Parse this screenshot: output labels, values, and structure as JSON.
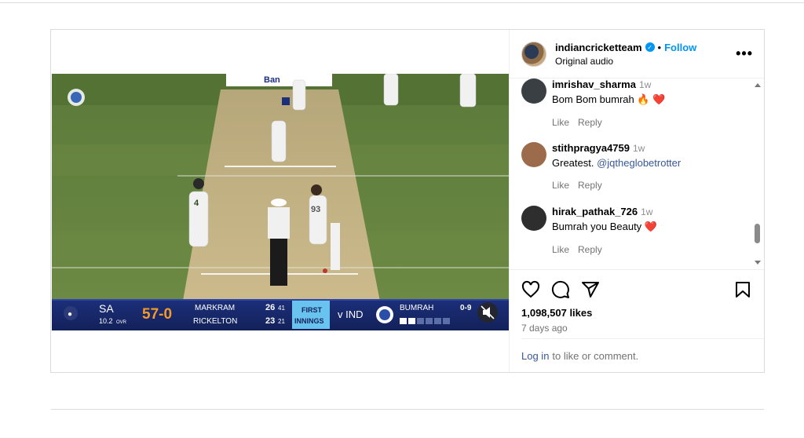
{
  "post": {
    "username": "indiancricketteam",
    "follow_label": "Follow",
    "dot": "•",
    "audio": "Original audio",
    "more": "•••"
  },
  "video": {
    "sponsor": "Ban",
    "scorebar": {
      "team": "SA",
      "overs": "10.2",
      "overs_unit": "OVR",
      "score": "57-0",
      "batter1": "MARKRAM",
      "batter1_runs": "26",
      "batter1_balls": "41",
      "batter2": "RICKELTON",
      "batter2_runs": "23",
      "batter2_balls": "21",
      "innings_line1": "FIRST",
      "innings_line2": "INNINGS",
      "vs": "v IND",
      "bowler": "BUMRAH",
      "bowler_fig": "0-9"
    },
    "jersey_batter": "4",
    "jersey_bowler": "93"
  },
  "comments": [
    {
      "user": "imrishav_sharma",
      "time": "1w",
      "text": "Bom Bom bumrah 🔥 ❤️",
      "like": "Like",
      "reply": "Reply",
      "avatar_color": "#3a3f44"
    },
    {
      "user": "stithpragya4759",
      "time": "1w",
      "text_prefix": "Greatest. ",
      "mention": "@jqtheglobetrotter",
      "like": "Like",
      "reply": "Reply",
      "avatar_color": "#9c6b4c"
    },
    {
      "user": "hirak_pathak_726",
      "time": "1w",
      "text": "Bumrah you Beauty ❤️",
      "like": "Like",
      "reply": "Reply",
      "avatar_color": "#2e2e2e"
    }
  ],
  "stats": {
    "likes": "1,098,507 likes",
    "date": "7 days ago"
  },
  "login": {
    "link": "Log in",
    "rest": "to like or comment."
  }
}
